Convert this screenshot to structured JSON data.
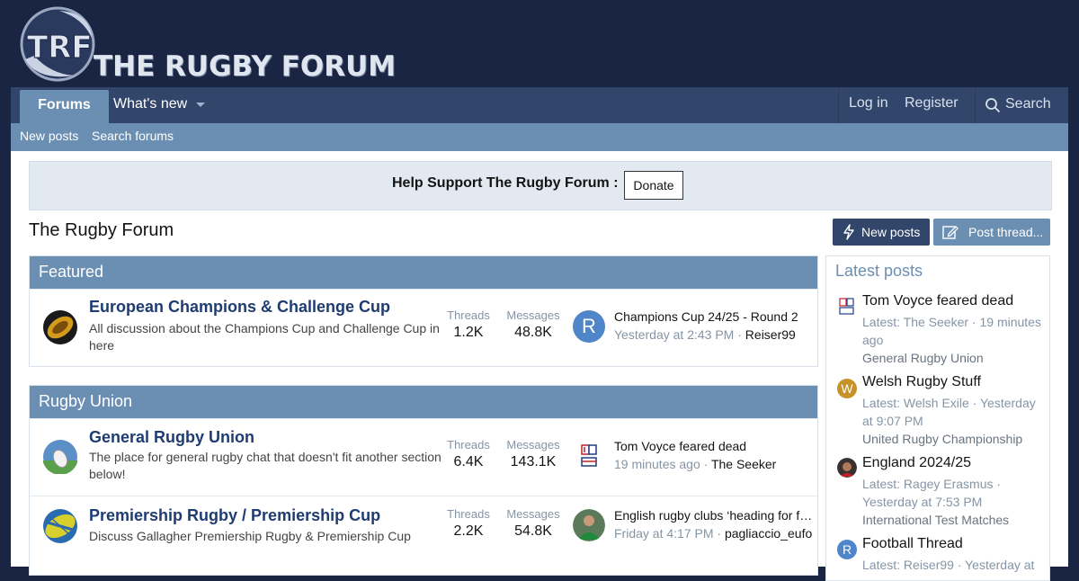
{
  "site": {
    "logo_text": "THE RUGBY FORUM",
    "logo_mark": "TRF"
  },
  "nav": {
    "tabs": [
      {
        "label": "Forums",
        "active": true
      },
      {
        "label": "What's new",
        "active": false
      }
    ],
    "login": "Log in",
    "register": "Register",
    "search": "Search"
  },
  "subnav": {
    "new_posts": "New posts",
    "search_forums": "Search forums"
  },
  "notice": {
    "text": "Help Support The Rugby Forum :",
    "donate": "Donate"
  },
  "page": {
    "title": "The Rugby Forum",
    "new_posts_button": "New posts",
    "post_thread_button": "Post thread..."
  },
  "categories": [
    {
      "title": "Featured",
      "nodes": [
        {
          "title": "European Champions & Challenge Cup",
          "description": "All discussion about the Champions Cup and Challenge Cup in here",
          "threads_label": "Threads",
          "threads": "1.2K",
          "messages_label": "Messages",
          "messages": "48.8K",
          "last_avatar_letter": "R",
          "last_title": "Champions Cup 24/25 - Round 2",
          "last_time": "Yesterday at 2:43 PM",
          "last_sep": "·",
          "last_user": "Reiser99"
        }
      ]
    },
    {
      "title": "Rugby Union",
      "nodes": [
        {
          "title": "General Rugby Union",
          "description": "The place for general rugby chat that doesn't fit another section below!",
          "threads_label": "Threads",
          "threads": "6.4K",
          "messages_label": "Messages",
          "messages": "143.1K",
          "last_title": "Tom Voyce feared dead",
          "last_time": "19 minutes ago",
          "last_sep": "·",
          "last_user": "The Seeker"
        },
        {
          "title": "Premiership Rugby / Premiership Cup",
          "description": "Discuss Gallagher Premiership Rugby & Premiership Cup",
          "threads_label": "Threads",
          "threads": "2.2K",
          "messages_label": "Messages",
          "messages": "54.8K",
          "last_title": "English rugby clubs ‘heading for financial ruin’",
          "last_time": "Friday at 4:17 PM",
          "last_sep": "·",
          "last_user": "pagliaccio_eufo"
        }
      ]
    }
  ],
  "latest_posts": {
    "heading": "Latest posts",
    "items": [
      {
        "title": "Tom Voyce feared dead",
        "meta": "Latest: The Seeker · 19 minutes ago",
        "forum": "General Rugby Union",
        "avatar_letter": ""
      },
      {
        "title": "Welsh Rugby Stuff",
        "meta": "Latest: Welsh Exile · Yesterday at 9:07 PM",
        "forum": "United Rugby Championship",
        "avatar_letter": "W"
      },
      {
        "title": "England 2024/25",
        "meta": "Latest: Ragey Erasmus · Yesterday at 7:53 PM",
        "forum": "International Test Matches",
        "avatar_letter": ""
      },
      {
        "title": "Football Thread",
        "meta": "Latest: Reiser99 · Yesterday at",
        "forum": "",
        "avatar_letter": "R"
      }
    ]
  },
  "colors": {
    "header_bg": "#1a2443",
    "nav_bg": "#32466b",
    "accent": "#6b8fb3",
    "link": "#1e3c72"
  }
}
